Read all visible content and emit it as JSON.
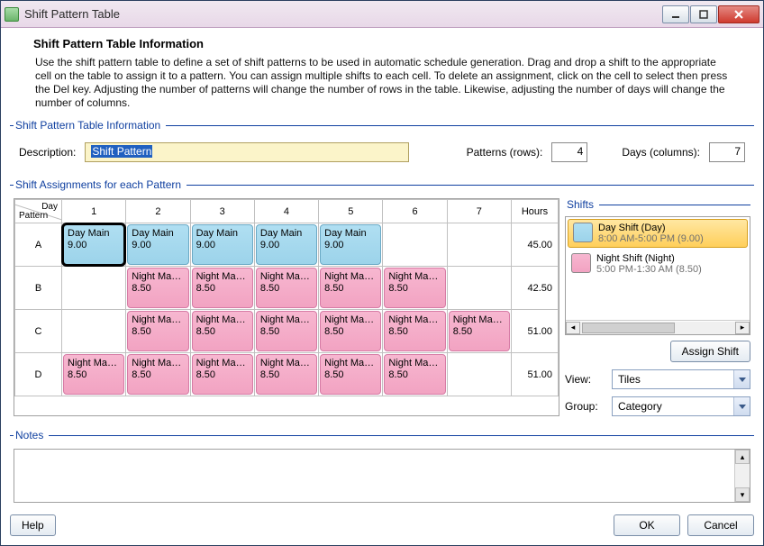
{
  "window": {
    "title": "Shift Pattern Table"
  },
  "header": {
    "heading": "Shift Pattern Table Information",
    "intro": "Use the shift pattern table to define a set of shift patterns to be used in automatic schedule generation. Drag and drop a shift to the appropriate cell on the table to assign it to a pattern. You can assign multiple shifts to each cell. To delete an assignment, click on the cell to select then press the Del key.  Adjusting the number of patterns will change the number of rows in the table. Likewise, adjusting the number of days will change the number of columns."
  },
  "info_group": {
    "legend": "Shift Pattern Table Information",
    "description_label": "Description:",
    "description_value": "Shift Pattern",
    "patterns_label": "Patterns (rows):",
    "patterns_value": "4",
    "days_label": "Days (columns):",
    "days_value": "7"
  },
  "assign_group": {
    "legend": "Shift Assignments for each Pattern"
  },
  "grid": {
    "corner_day": "Day",
    "corner_pattern": "Pattern",
    "day_headers": [
      "1",
      "2",
      "3",
      "4",
      "5",
      "6",
      "7"
    ],
    "hours_header": "Hours",
    "rows": [
      {
        "label": "A",
        "hours": "45.00",
        "cells": [
          {
            "t": "day",
            "label": "Day Main",
            "val": "9.00",
            "selected": true
          },
          {
            "t": "day",
            "label": "Day Main",
            "val": "9.00"
          },
          {
            "t": "day",
            "label": "Day Main",
            "val": "9.00"
          },
          {
            "t": "day",
            "label": "Day Main",
            "val": "9.00"
          },
          {
            "t": "day",
            "label": "Day Main",
            "val": "9.00"
          },
          null,
          null
        ]
      },
      {
        "label": "B",
        "hours": "42.50",
        "cells": [
          null,
          {
            "t": "night",
            "label": "Night Ma…",
            "val": "8.50"
          },
          {
            "t": "night",
            "label": "Night Ma…",
            "val": "8.50"
          },
          {
            "t": "night",
            "label": "Night Ma…",
            "val": "8.50"
          },
          {
            "t": "night",
            "label": "Night Ma…",
            "val": "8.50"
          },
          {
            "t": "night",
            "label": "Night Ma…",
            "val": "8.50"
          },
          null
        ]
      },
      {
        "label": "C",
        "hours": "51.00",
        "cells": [
          null,
          {
            "t": "night",
            "label": "Night Ma…",
            "val": "8.50"
          },
          {
            "t": "night",
            "label": "Night Ma…",
            "val": "8.50"
          },
          {
            "t": "night",
            "label": "Night Ma…",
            "val": "8.50"
          },
          {
            "t": "night",
            "label": "Night Ma…",
            "val": "8.50"
          },
          {
            "t": "night",
            "label": "Night Ma…",
            "val": "8.50"
          },
          {
            "t": "night",
            "label": "Night Ma…",
            "val": "8.50"
          }
        ]
      },
      {
        "label": "D",
        "hours": "51.00",
        "cells": [
          {
            "t": "night",
            "label": "Night Ma…",
            "val": "8.50"
          },
          {
            "t": "night",
            "label": "Night Ma…",
            "val": "8.50"
          },
          {
            "t": "night",
            "label": "Night Ma…",
            "val": "8.50"
          },
          {
            "t": "night",
            "label": "Night Ma…",
            "val": "8.50"
          },
          {
            "t": "night",
            "label": "Night Ma…",
            "val": "8.50"
          },
          {
            "t": "night",
            "label": "Night Ma…",
            "val": "8.50"
          },
          null
        ]
      }
    ]
  },
  "shifts_panel": {
    "legend": "Shifts",
    "items": [
      {
        "swatch": "day",
        "title": "Day Shift (Day)",
        "sub": "8:00 AM-5:00 PM (9.00)",
        "selected": true
      },
      {
        "swatch": "night",
        "title": "Night Shift (Night)",
        "sub": "5:00 PM-1:30 AM (8.50)",
        "selected": false
      }
    ],
    "assign_button": "Assign Shift",
    "view_label": "View:",
    "view_value": "Tiles",
    "group_label": "Group:",
    "group_value": "Category"
  },
  "notes": {
    "legend": "Notes"
  },
  "footer": {
    "help": "Help",
    "ok": "OK",
    "cancel": "Cancel"
  }
}
